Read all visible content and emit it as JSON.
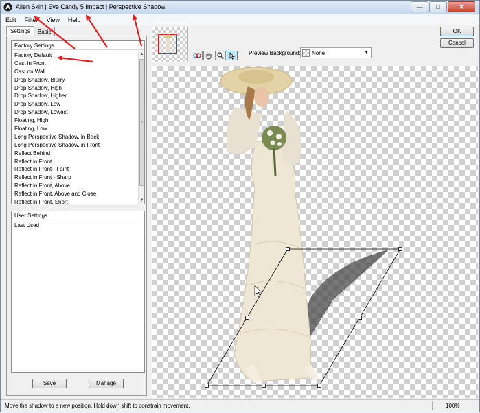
{
  "window": {
    "title": "Alien Skin | Eye Candy 5 Impact | Perspective Shadow",
    "controls": [
      "minimize",
      "maximize",
      "close"
    ]
  },
  "menu": {
    "items": [
      "Edit",
      "Filter",
      "View",
      "Help"
    ]
  },
  "tabs": [
    {
      "label": "Settings",
      "active": true
    },
    {
      "label": "Basic",
      "active": false
    }
  ],
  "factory_settings": {
    "header": "Factory Settings",
    "items": [
      "Factory Default",
      "Cast in Front",
      "Cast on Wall",
      "Drop Shadow, Blurry",
      "Drop Shadow, High",
      "Drop Shadow, Higher",
      "Drop Shadow, Low",
      "Drop Shadow, Lowest",
      "Floating, High",
      "Floating, Low",
      "Long Perspective Shadow, in Back",
      "Long Perspective Shadow, in Front",
      "Reflect Behind",
      "Reflect in Front",
      "Reflect in Front - Faint",
      "Reflect in Front - Sharp",
      "Reflect in Front, Above",
      "Reflect in Front, Above and Close",
      "Reflect in Front, Short"
    ]
  },
  "user_settings": {
    "header": "User Settings",
    "items": [
      "Last Used"
    ]
  },
  "buttons": {
    "save": "Save",
    "manage": "Manage",
    "ok": "OK",
    "cancel": "Cancel"
  },
  "toolbar": {
    "tools": [
      "preview-hand-icon",
      "hand-icon",
      "zoom-icon",
      "pointer-icon"
    ],
    "preview_background_label": "Preview Background:",
    "preview_background_value": "None"
  },
  "status": {
    "message": "Move the shadow to a new position. Hold down shift to constrain movement.",
    "zoom": "100%"
  },
  "colors": {
    "annotation_arrow": "#e02020",
    "titlebar": "#c6d7ec",
    "dress": "#efe7d6",
    "hat": "#e3d3a6",
    "shadow": "#4a4a4a"
  }
}
